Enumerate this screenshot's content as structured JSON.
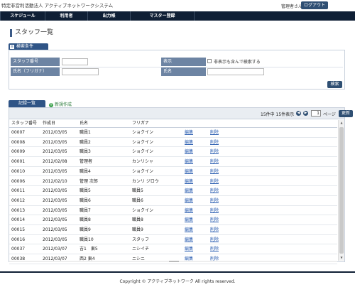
{
  "header": {
    "app_title": "特定非営利活動法人 アクティブネットワークシステム",
    "user_name": "管理者さん",
    "logout_label": "ログアウト"
  },
  "nav": {
    "items": [
      {
        "label": "スケジュール"
      },
      {
        "label": "利用者"
      },
      {
        "label": "出力帳"
      },
      {
        "label": "マスター登録"
      }
    ]
  },
  "page": {
    "title": "スタッフ一覧"
  },
  "search": {
    "tab_label": "検索条件",
    "staff_no_label": "スタッフ番号",
    "staff_no_value": "",
    "display_label": "表示",
    "include_hidden_label": "非表示も含んで検索する",
    "include_hidden_checked": false,
    "kana_label": "氏名（フリガナ）",
    "kana_value": "",
    "name_label": "氏名",
    "name_value": "",
    "search_button": "検索"
  },
  "records": {
    "tab_label": "記録一覧",
    "new_label": "新規作成",
    "count_text": "15件中 15件表示",
    "prev_icon": "prev-page-icon",
    "next_icon": "next-page-icon",
    "page_number": "1",
    "page_label": "ページ",
    "refresh_button": "更新",
    "columns": [
      "スタッフ番号",
      "作成日",
      "氏名",
      "フリガナ",
      "",
      "",
      ""
    ],
    "edit_label": "編集",
    "delete_label": "削除",
    "rows": [
      {
        "no": "00007",
        "date": "2012/03/05",
        "name": "職員1",
        "kana": "ショクイン"
      },
      {
        "no": "00008",
        "date": "2012/03/05",
        "name": "職員2",
        "kana": "ショクイン"
      },
      {
        "no": "00009",
        "date": "2012/03/05",
        "name": "職員3",
        "kana": "ショクイン"
      },
      {
        "no": "00001",
        "date": "2012/02/08",
        "name": "管理者",
        "kana": "カンリシャ"
      },
      {
        "no": "00010",
        "date": "2012/03/05",
        "name": "職員4",
        "kana": "ショクイン"
      },
      {
        "no": "00006",
        "date": "2012/02/10",
        "name": "管理 次郎",
        "kana": "カンリ ジロウ"
      },
      {
        "no": "00011",
        "date": "2012/03/05",
        "name": "職員5",
        "kana": "職員5"
      },
      {
        "no": "00012",
        "date": "2012/03/05",
        "name": "職員6",
        "kana": "職員6"
      },
      {
        "no": "00013",
        "date": "2012/03/05",
        "name": "職員7",
        "kana": "ショクイン"
      },
      {
        "no": "00014",
        "date": "2012/03/05",
        "name": "職員8",
        "kana": "職員8"
      },
      {
        "no": "00015",
        "date": "2012/03/05",
        "name": "職員9",
        "kana": "職員9"
      },
      {
        "no": "00016",
        "date": "2012/03/05",
        "name": "職員10",
        "kana": "スタッフ"
      },
      {
        "no": "00037",
        "date": "2012/03/07",
        "name": "吉1　東5",
        "kana": "ニシイチ"
      },
      {
        "no": "00038",
        "date": "2012/03/07",
        "name": "西2 東4",
        "kana": "ニシニ"
      }
    ]
  },
  "footer": {
    "copyright": "Copyright © アクティブネットワーク All rights reserved."
  },
  "colors": {
    "nav_bg": "#0f1f35",
    "accent": "#2f5486",
    "label_bg": "#6d84a3",
    "link": "#2a5db0"
  }
}
